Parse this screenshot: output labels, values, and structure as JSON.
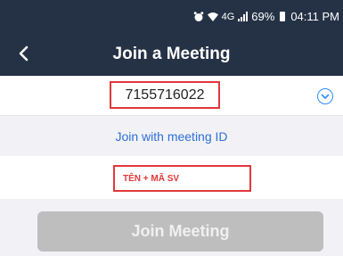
{
  "status_bar": {
    "signal_label": "4G",
    "battery": "69%",
    "time": "04:11 PM",
    "alarm_icon": "alarm-icon",
    "wifi_icon": "wifi-icon"
  },
  "header": {
    "title": "Join a Meeting",
    "back_icon": "chevron-left-icon"
  },
  "meeting": {
    "id_value": "7155716022",
    "dropdown_icon": "chevron-down-circle-icon"
  },
  "join_with_id_label": "Join with meeting ID",
  "name_field": {
    "value": "TÊN + MÃ SV"
  },
  "join_button_label": "Join Meeting",
  "colors": {
    "header_bg": "#253246",
    "accent": "#2d8cff",
    "highlight_border": "#e0383a",
    "disabled_button": "#bebebe"
  }
}
